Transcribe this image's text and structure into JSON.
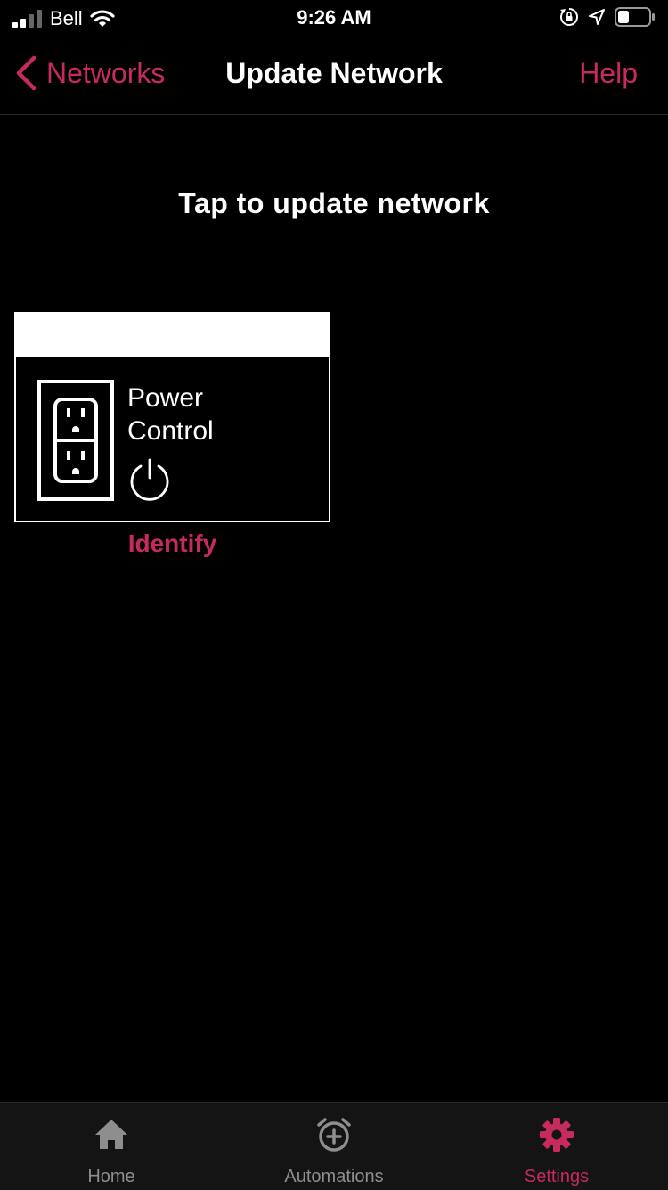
{
  "status_bar": {
    "carrier": "Bell",
    "time": "9:26 AM"
  },
  "nav": {
    "back_label": "Networks",
    "title": "Update Network",
    "help_label": "Help"
  },
  "main": {
    "instruction": "Tap to update network",
    "devices": [
      {
        "name_line1": "Power",
        "name_line2": "Control",
        "action_label": "Identify"
      }
    ]
  },
  "tab_bar": {
    "tabs": [
      {
        "label": "Home",
        "icon": "home-icon",
        "active": false
      },
      {
        "label": "Automations",
        "icon": "alarm-plus-icon",
        "active": false
      },
      {
        "label": "Settings",
        "icon": "gear-icon",
        "active": true
      }
    ]
  },
  "colors": {
    "accent": "#c72a5c",
    "inactive": "#8e8e8e",
    "background": "#000000",
    "tab_bar_bg": "#141414"
  }
}
